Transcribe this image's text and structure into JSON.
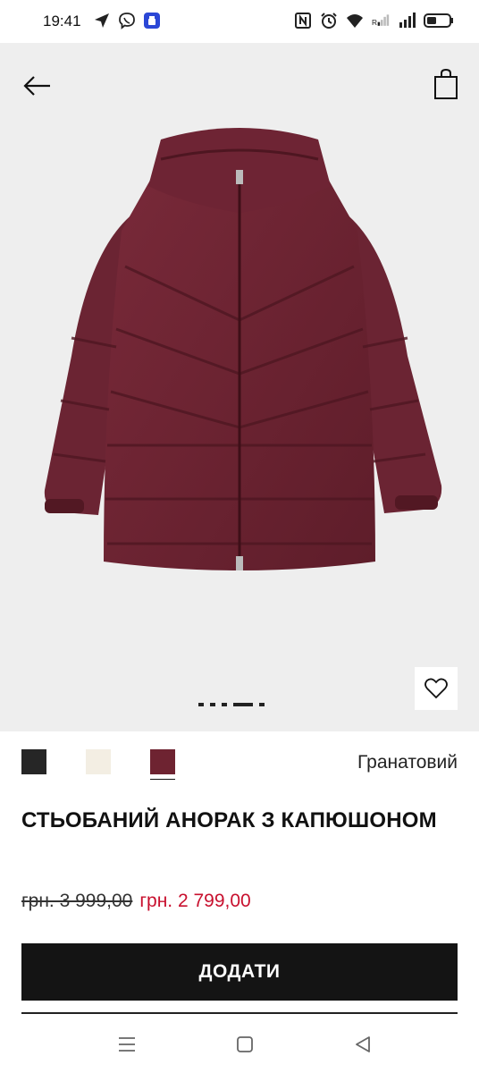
{
  "status_bar": {
    "time": "19:41",
    "left_icons": [
      "navigation-arrow-icon",
      "viber-icon",
      "app-badge-icon"
    ],
    "right_icons": [
      "nfc-icon",
      "alarm-icon",
      "wifi-icon",
      "signal-r-icon",
      "signal-icon",
      "battery-icon"
    ]
  },
  "header": {
    "back_icon": "arrow-left-icon",
    "bag_icon": "shopping-bag-icon"
  },
  "gallery": {
    "image": "burgundy quilted hooded anorak",
    "image_count": 5,
    "active_index": 3
  },
  "favorite_icon": "heart-icon",
  "colors": {
    "swatches": [
      {
        "name": "black",
        "hex": "#262626"
      },
      {
        "name": "cream",
        "hex": "#f3eee3"
      },
      {
        "name": "garnet",
        "hex": "#6e2331"
      }
    ],
    "selected_index": 2,
    "selected_label": "Гранатовий"
  },
  "product": {
    "title": "СТЬОБАНИЙ АНОРАК З КАПЮШОНОМ",
    "price_old": "грн. 3 999,00",
    "price_new": "грн. 2 799,00"
  },
  "add_button_label": "ДОДАТИ",
  "accent_colors": {
    "sale": "#c8102e",
    "button": "#141414"
  },
  "nav_bar": {
    "icons": [
      "menu-icon",
      "home-square-icon",
      "back-triangle-icon"
    ]
  }
}
